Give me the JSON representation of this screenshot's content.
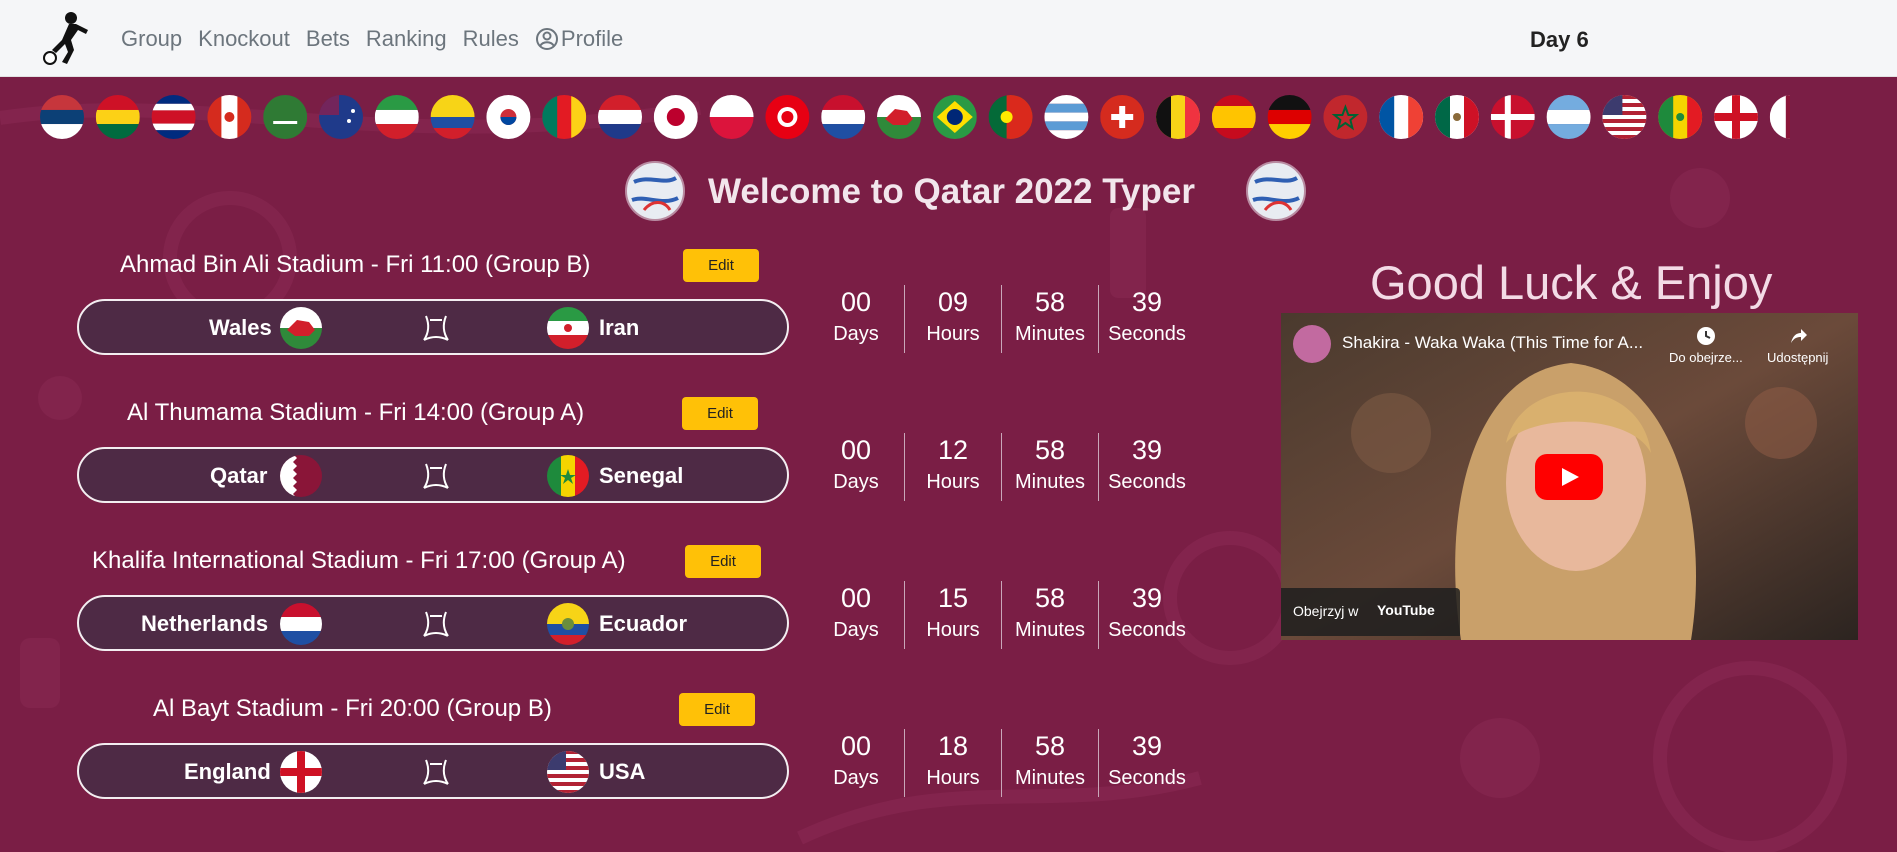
{
  "nav": {
    "links": [
      "Group",
      "Knockout",
      "Bets",
      "Ranking",
      "Rules",
      "Profile"
    ],
    "day": "Day 6"
  },
  "flags": [
    "serbia",
    "ghana",
    "costa-rica",
    "canada",
    "saudi-arabia",
    "australia",
    "iran",
    "ecuador",
    "south-korea",
    "cameroon",
    "croatia",
    "japan",
    "poland",
    "tunisia",
    "netherlands",
    "wales",
    "brazil",
    "portugal",
    "uruguay",
    "switzerland",
    "belgium",
    "spain",
    "germany",
    "morocco",
    "france",
    "mexico",
    "denmark",
    "argentina",
    "usa",
    "senegal",
    "england",
    "qatar"
  ],
  "title": "Welcome to Qatar 2022 Typer",
  "matches": [
    {
      "stadium": "Ahmad Bin Ali Stadium - Fri 11:00 (Group B)",
      "edit": "Edit",
      "home": "Wales",
      "home_flag": "wales",
      "away": "Iran",
      "away_flag": "iran",
      "countdown": {
        "days": "00",
        "hours": "09",
        "minutes": "58",
        "seconds": "39"
      }
    },
    {
      "stadium": "Al Thumama Stadium - Fri 14:00 (Group A)",
      "edit": "Edit",
      "home": "Qatar",
      "home_flag": "qatar",
      "away": "Senegal",
      "away_flag": "senegal",
      "countdown": {
        "days": "00",
        "hours": "12",
        "minutes": "58",
        "seconds": "39"
      }
    },
    {
      "stadium": "Khalifa International Stadium - Fri 17:00 (Group A)",
      "edit": "Edit",
      "home": "Netherlands",
      "home_flag": "netherlands",
      "away": "Ecuador",
      "away_flag": "ecuador",
      "countdown": {
        "days": "00",
        "hours": "15",
        "minutes": "58",
        "seconds": "39"
      }
    },
    {
      "stadium": "Al Bayt Stadium - Fri 20:00 (Group B)",
      "edit": "Edit",
      "home": "England",
      "home_flag": "england",
      "away": "USA",
      "away_flag": "usa",
      "countdown": {
        "days": "00",
        "hours": "18",
        "minutes": "58",
        "seconds": "39"
      }
    }
  ],
  "countdown_labels": {
    "days": "Days",
    "hours": "Hours",
    "minutes": "Minutes",
    "seconds": "Seconds"
  },
  "right": {
    "headline": "Good Luck & Enjoy",
    "video": {
      "title": "Shakira - Waka Waka (This Time for A...",
      "watch_later": "Do obejrze...",
      "share": "Udostępnij",
      "watch_on": "Obejrzyj w",
      "platform": "YouTube"
    }
  },
  "colors": {
    "background": "#7a1e45",
    "edit_button": "#ffc107",
    "navbar": "#f5f6f8"
  }
}
